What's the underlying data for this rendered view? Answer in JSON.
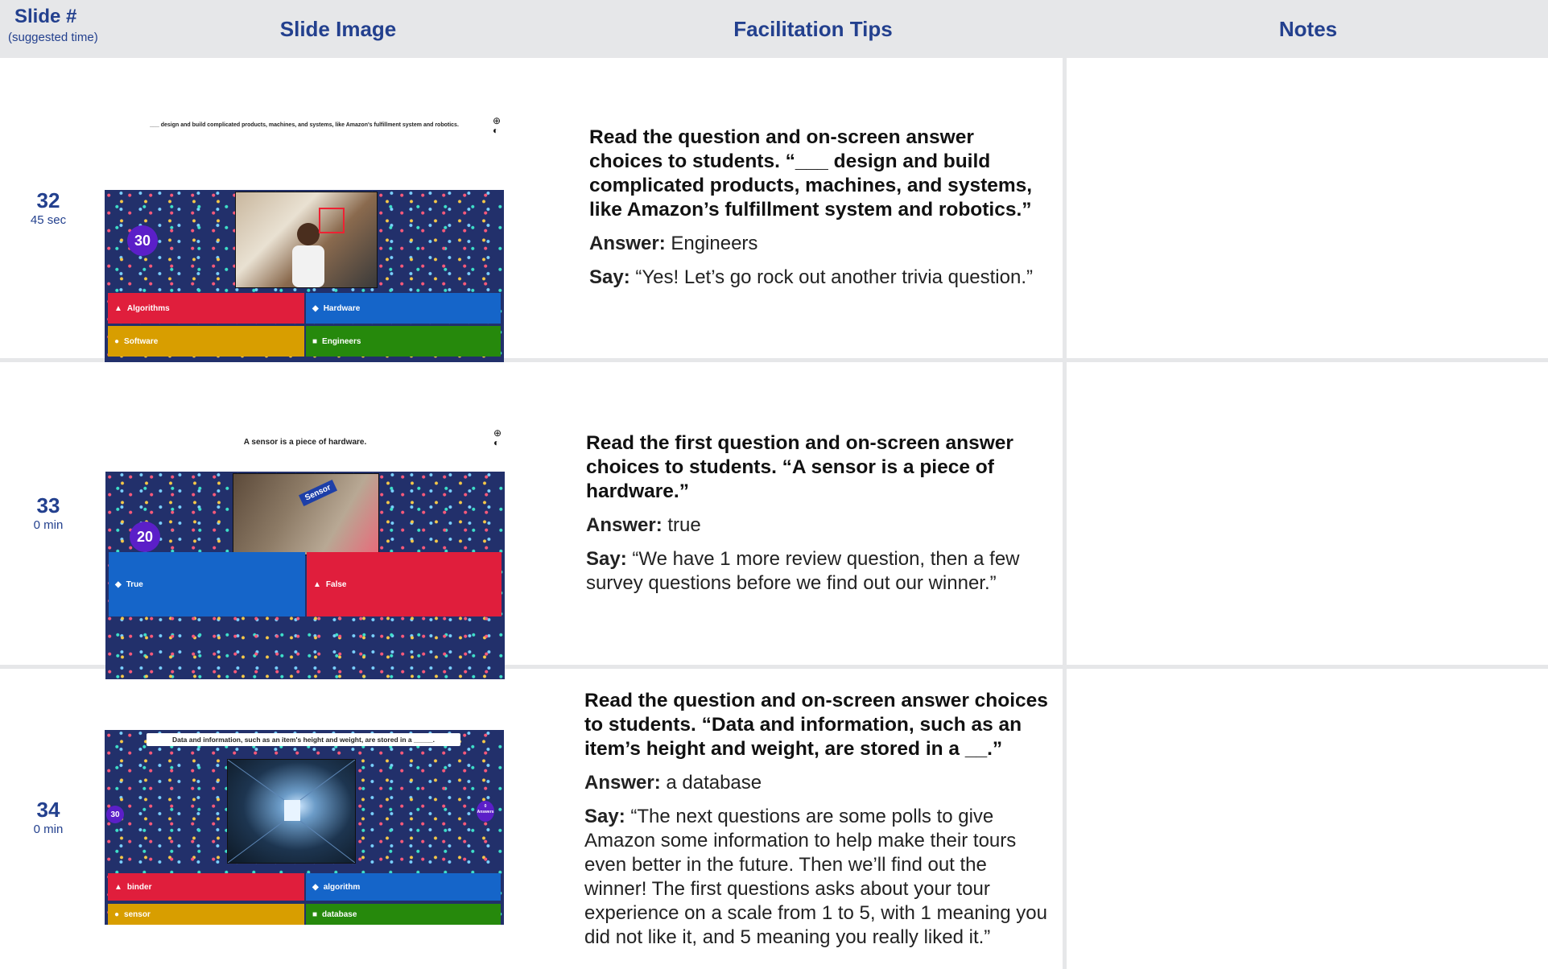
{
  "header": {
    "slide_label": "Slide #",
    "slide_sub": "(suggested time)",
    "image_label": "Slide Image",
    "tips_label": "Facilitation Tips",
    "notes_label": "Notes"
  },
  "rows": [
    {
      "num": "32",
      "time": "45 sec",
      "slide": {
        "question": "___ design and build complicated products, machines, and systems, like Amazon's fulfillment system and robotics.",
        "timer": "30",
        "answers": [
          {
            "label": "Algorithms",
            "symbol": "▲",
            "color": "red"
          },
          {
            "label": "Hardware",
            "symbol": "◆",
            "color": "blue"
          },
          {
            "label": "Software",
            "symbol": "●",
            "color": "gold"
          },
          {
            "label": "Engineers",
            "symbol": "■",
            "color": "green"
          }
        ]
      },
      "tips": {
        "lead": "Read the question and on-screen answer choices to students. “___ design and build complicated products, machines, and systems, like Amazon’s fulfillment system and robotics.”",
        "answer_label": "Answer:",
        "answer": " Engineers",
        "say_label": "Say:",
        "say": " “Yes! Let’s go rock out another trivia question.”"
      }
    },
    {
      "num": "33",
      "time": "0 min",
      "slide": {
        "question": "A sensor is a piece of hardware.",
        "timer": "20",
        "photo_label": "Sensor",
        "answers": [
          {
            "label": "True",
            "symbol": "◆",
            "color": "blue"
          },
          {
            "label": "False",
            "symbol": "▲",
            "color": "red"
          }
        ]
      },
      "tips": {
        "lead": "Read the first question and on-screen answer choices to students. “A sensor is a piece of hardware.”",
        "answer_label": "Answer:",
        "answer": " true",
        "say_label": "Say:",
        "say": " “We have 1 more review question, then a few survey questions before we find out our winner.”"
      }
    },
    {
      "num": "34",
      "time": "0 min",
      "slide": {
        "question": "Data and information, such as an item's height and weight, are stored in a _____.",
        "timer": "30",
        "answers_count": "0",
        "answers_word": "Answers",
        "answers": [
          {
            "label": "binder",
            "symbol": "▲",
            "color": "red"
          },
          {
            "label": "algorithm",
            "symbol": "◆",
            "color": "blue"
          },
          {
            "label": "sensor",
            "symbol": "●",
            "color": "gold"
          },
          {
            "label": "database",
            "symbol": "■",
            "color": "green"
          }
        ]
      },
      "tips": {
        "lead": "Read the question and on-screen answer choices to students.  “Data and information, such as an item’s height and weight, are stored in a __.”",
        "answer_label": "Answer:",
        "answer": " a database",
        "say_label": "Say:",
        "say": " “The next questions are some polls to give Amazon some information to help make their tours even better in the future. Then we’ll find out the winner! The first questions asks about your tour experience on a scale from 1 to 5, with 1 meaning you did not like it, and 5 meaning you really liked it.”"
      }
    }
  ]
}
